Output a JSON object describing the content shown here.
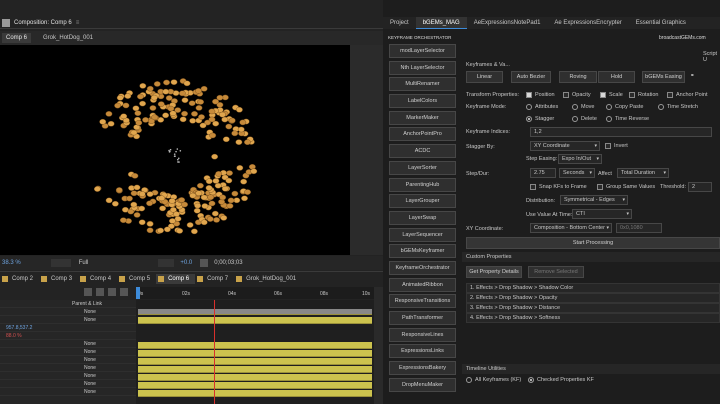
{
  "comp_panel": {
    "title": "Composition: Comp 6",
    "tabs": [
      {
        "label": "Comp 6",
        "active": true
      },
      {
        "label": "Grok_HotDog_001",
        "active": false
      }
    ]
  },
  "viewer_bar": {
    "zoom": "38.3 %",
    "resolution": "Full",
    "exposure": "+0.0",
    "timecode": "0;00;03;03"
  },
  "timeline_tabs": [
    {
      "label": "Comp 2"
    },
    {
      "label": "Comp 3"
    },
    {
      "label": "Comp 4"
    },
    {
      "label": "Comp 5"
    },
    {
      "label": "Comp 6",
      "active": true
    },
    {
      "label": "Comp 7"
    },
    {
      "label": "Grok_HotDog_001"
    }
  ],
  "ruler": {
    "marks": [
      "0s",
      "02s",
      "04s",
      "06s",
      "08s",
      "10s"
    ]
  },
  "layers": {
    "header": "Parent & Link",
    "parent_value": "None",
    "property_value_1": "957.8,537.2",
    "property_value_2": "88.0 %"
  },
  "right_tabs": [
    {
      "label": "Project"
    },
    {
      "label": "bGEMs_MAG",
      "active": true
    },
    {
      "label": "AeExpressionsNotePad1"
    },
    {
      "label": "Ae ExpressionsEncrypter"
    },
    {
      "label": "Essential Graphics"
    }
  ],
  "brand": {
    "left": "KEYFRAME ORCHESTRATOR",
    "right": "broadcastGEMs.com"
  },
  "script_label": "Script U",
  "sidebar_buttons": [
    "modLayerSelector",
    "Nth LayerSelector",
    "MultiRenamer",
    "LabelColors",
    "MarkerMaker",
    "AnchorPointPro",
    "ACDC",
    "LayerSorter",
    "ParentingHub",
    "LayerGrouper",
    "LayerSwap",
    "LayerSequencer",
    "bGEMsKeyframer",
    "KeyframeOrchestrator",
    "AnimatedRibbon",
    "ResponsiveTransitions",
    "PathTransformer",
    "ResponsiveLines",
    "ExpressionsLinks",
    "ExpressionsBakery",
    "DropMenuMaker"
  ],
  "keyframes": {
    "section": "Keyframes & Va...",
    "buttons": [
      "Linear",
      "Auto Bezier",
      "Roving",
      "Hold",
      "bGEMs Easing"
    ]
  },
  "transform": {
    "label": "Transform Properties:",
    "items": [
      {
        "label": "Position",
        "checked": true
      },
      {
        "label": "Opacity",
        "checked": false
      },
      {
        "label": "Scale",
        "checked": true
      },
      {
        "label": "Rotation",
        "checked": false
      },
      {
        "label": "Anchor Point",
        "checked": false
      }
    ]
  },
  "keyframe_mode": {
    "label": "Keyframe Mode:",
    "row1": [
      {
        "label": "Attributes",
        "on": false
      },
      {
        "label": "Move",
        "on": false
      },
      {
        "label": "Copy Paste",
        "on": false
      },
      {
        "label": "Time Stretch",
        "on": false
      }
    ],
    "row2": [
      {
        "label": "Stagger",
        "on": true
      },
      {
        "label": "Delete",
        "on": false
      },
      {
        "label": "Time Reverse",
        "on": false
      }
    ]
  },
  "indices": {
    "label": "Keyframe Indices:",
    "value": "1,2"
  },
  "stagger_by": {
    "label": "Stagger By:",
    "value": "XY Coordinate",
    "invert": "Invert"
  },
  "step_easing": {
    "label": "Step Easing:",
    "value": "Expo In/Out"
  },
  "step_dur": {
    "label": "Step/Dur:",
    "value": "2.75",
    "unit": "Seconds",
    "affect_label": "Affect",
    "affect_value": "Total Duration"
  },
  "snap": {
    "snap": "Snap KFs to Frame",
    "group": "Group Same Values",
    "threshold_label": "Threshold:",
    "threshold_value": "2"
  },
  "distribution": {
    "label": "Distribution:",
    "value": "Symmetrical - Edges"
  },
  "use_value": {
    "label": "Use Value At Time:",
    "value": "CTI"
  },
  "xy_coord": {
    "label": "XY Coordinate:",
    "value": "Composition - Bottom Center",
    "extra": "0x0,1080"
  },
  "start_btn": "Start Processing",
  "custom_props": {
    "label": "Custom Properties",
    "get": "Get Property Details",
    "remove": "Remove Selected",
    "items": [
      "1. Effects > Drop Shadow > Shadow Color",
      "2. Effects > Drop Shadow > Opacity",
      "3. Effects > Drop Shadow > Distance",
      "4. Effects > Drop Shadow > Softness"
    ]
  },
  "timeline_util": {
    "label": "Timeline Utilities",
    "opt1": "All Keyframes (KF)",
    "opt2": "Checked Properties KF"
  }
}
